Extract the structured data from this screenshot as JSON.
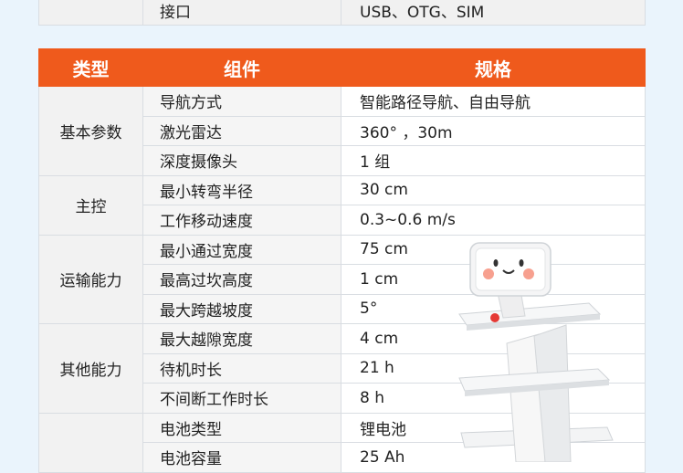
{
  "top_row": {
    "component": "接口",
    "spec": "USB、OTG、SIM"
  },
  "header": {
    "type": "类型",
    "component": "组件",
    "spec": "规格"
  },
  "groups": [
    {
      "type": "基本参数",
      "rows": [
        {
          "component": "导航方式",
          "spec": "智能路径导航、自由导航"
        },
        {
          "component": "激光雷达",
          "spec": "360° ，30m"
        },
        {
          "component": "深度摄像头",
          "spec": "1 组"
        }
      ]
    },
    {
      "type": "主控",
      "rows": [
        {
          "component": "最小转弯半径",
          "spec": "30 cm"
        },
        {
          "component": "工作移动速度",
          "spec": "0.3~0.6 m/s"
        }
      ]
    },
    {
      "type": "运输能力",
      "rows": [
        {
          "component": "最小通过宽度",
          "spec": "75 cm"
        },
        {
          "component": "最高过坎高度",
          "spec": "1 cm"
        },
        {
          "component": "最大跨越坡度",
          "spec": "5°"
        }
      ]
    },
    {
      "type": "其他能力",
      "rows": [
        {
          "component": "最大越隙宽度",
          "spec": "4 cm"
        },
        {
          "component": "待机时长",
          "spec": "21 h"
        },
        {
          "component": "不间断工作时长",
          "spec": "8 h"
        }
      ]
    },
    {
      "type": "",
      "rows": [
        {
          "component": "电池类型",
          "spec": "锂电池"
        },
        {
          "component": "电池容量",
          "spec": "25 Ah"
        }
      ]
    }
  ]
}
